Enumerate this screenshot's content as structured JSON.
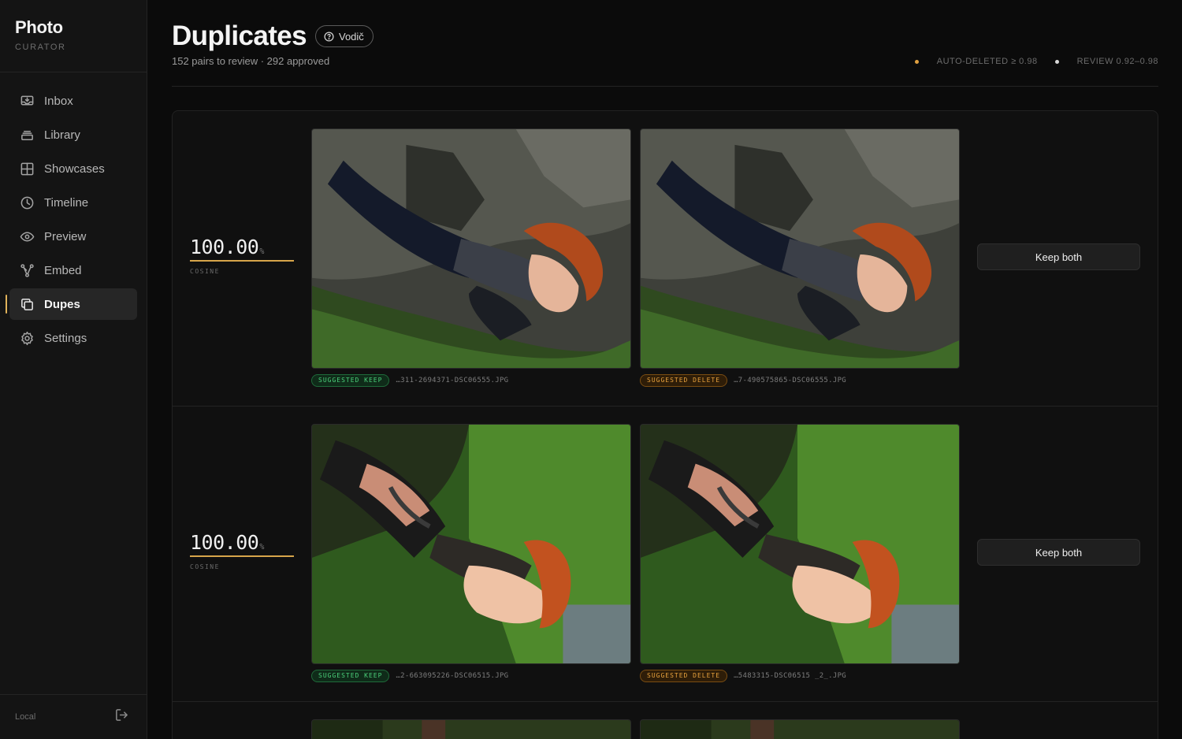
{
  "app": {
    "name": "Photo",
    "subtitle": "CURATOR"
  },
  "sidebar": {
    "items": [
      {
        "label": "Inbox",
        "icon": "inbox-icon"
      },
      {
        "label": "Library",
        "icon": "library-icon"
      },
      {
        "label": "Showcases",
        "icon": "grid-icon"
      },
      {
        "label": "Timeline",
        "icon": "clock-icon"
      },
      {
        "label": "Preview",
        "icon": "eye-icon"
      },
      {
        "label": "Embed",
        "icon": "embed-icon"
      },
      {
        "label": "Dupes",
        "icon": "copy-icon",
        "active": true
      },
      {
        "label": "Settings",
        "icon": "gear-icon"
      }
    ],
    "footer": {
      "label": "Local",
      "icon": "logout-icon"
    }
  },
  "header": {
    "title": "Duplicates",
    "guide_label": "Vodič",
    "subtitle": "152 pairs to review · 292 approved",
    "legend": [
      {
        "label": "AUTO-DELETED ≥ 0.98",
        "color": "#e0a040"
      },
      {
        "label": "REVIEW 0.92–0.98",
        "color": "#d8d8d8"
      }
    ]
  },
  "pairs": [
    {
      "score": "100.00",
      "unit": "%",
      "metric": "COSINE",
      "left": {
        "badge": "SUGGESTED KEEP",
        "file": "…311-2694371-DSC06555.JPG"
      },
      "right": {
        "badge": "SUGGESTED DELETE",
        "file": "…7-490575865-DSC06555.JPG"
      },
      "action": "Keep both"
    },
    {
      "score": "100.00",
      "unit": "%",
      "metric": "COSINE",
      "left": {
        "badge": "SUGGESTED KEEP",
        "file": "…2-663095226-DSC06515.JPG"
      },
      "right": {
        "badge": "SUGGESTED DELETE",
        "file": "…5483315-DSC06515 _2_.JPG"
      },
      "action": "Keep both"
    }
  ]
}
